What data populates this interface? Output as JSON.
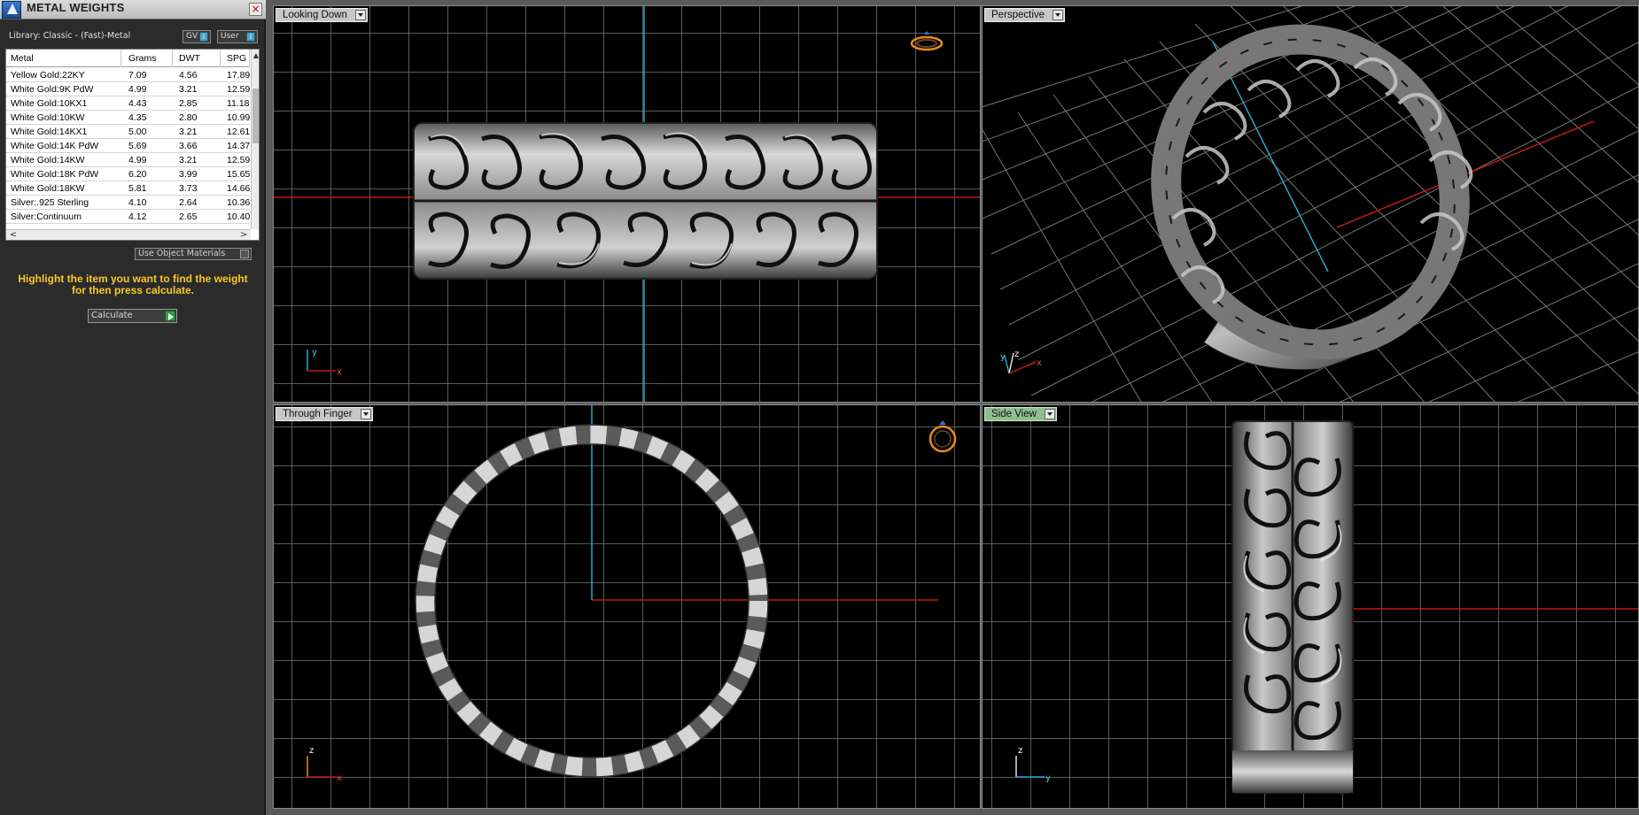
{
  "panel": {
    "title": "METAL WEIGHTS",
    "close": "×",
    "library": "Library: Classic - (Fast)-Metal",
    "gv_label": "GV",
    "user_label": "User",
    "toggle_mark": "i",
    "columns": [
      "Metal",
      "Grams",
      "DWT",
      "SPG"
    ],
    "rows": [
      [
        "Yellow Gold:22KY",
        "7.09",
        "4.56",
        "17.89"
      ],
      [
        "White Gold:9K PdW",
        "4.99",
        "3.21",
        "12.59"
      ],
      [
        "White Gold:10KX1",
        "4.43",
        "2.85",
        "11.18"
      ],
      [
        "White Gold:10KW",
        "4.35",
        "2.80",
        "10.99"
      ],
      [
        "White Gold:14KX1",
        "5.00",
        "3.21",
        "12.61"
      ],
      [
        "White Gold:14K PdW",
        "5.69",
        "3.66",
        "14.37"
      ],
      [
        "White Gold:14KW",
        "4.99",
        "3.21",
        "12.59"
      ],
      [
        "White Gold:18K PdW",
        "6.20",
        "3.99",
        "15.65"
      ],
      [
        "White Gold:18KW",
        "5.81",
        "3.73",
        "14.66"
      ],
      [
        "Silver:.925 Sterling",
        "4.10",
        "2.64",
        "10.36"
      ],
      [
        "Silver:Continuum",
        "4.12",
        "2.65",
        "10.40"
      ]
    ],
    "use_object_materials": "Use Object Materials",
    "hint_line1": "Highlight the item you want to find the weight",
    "hint_line2": "for then press calculate.",
    "calculate": "Calculate",
    "scroll_up": "▲",
    "scroll_left": "<",
    "scroll_right": ">"
  },
  "viewports": {
    "top": {
      "label": "Looking Down",
      "axis_v": "y",
      "axis_h": "x"
    },
    "perspective": {
      "label": "Perspective",
      "axis_a": "y",
      "axis_b": "z",
      "axis_c": "x"
    },
    "front": {
      "label": "Through Finger",
      "axis_v": "z",
      "axis_h": "x"
    },
    "side": {
      "label": "Side View",
      "axis_v": "z",
      "axis_h": "y"
    }
  },
  "colors": {
    "axis_red": "#c01818",
    "axis_cyan": "#2aa8c8",
    "metal_light": "#e6e6e6",
    "metal_dark": "#3a3a3a",
    "hint_yellow": "#f7c928",
    "active_view": "#8fbf8f"
  }
}
